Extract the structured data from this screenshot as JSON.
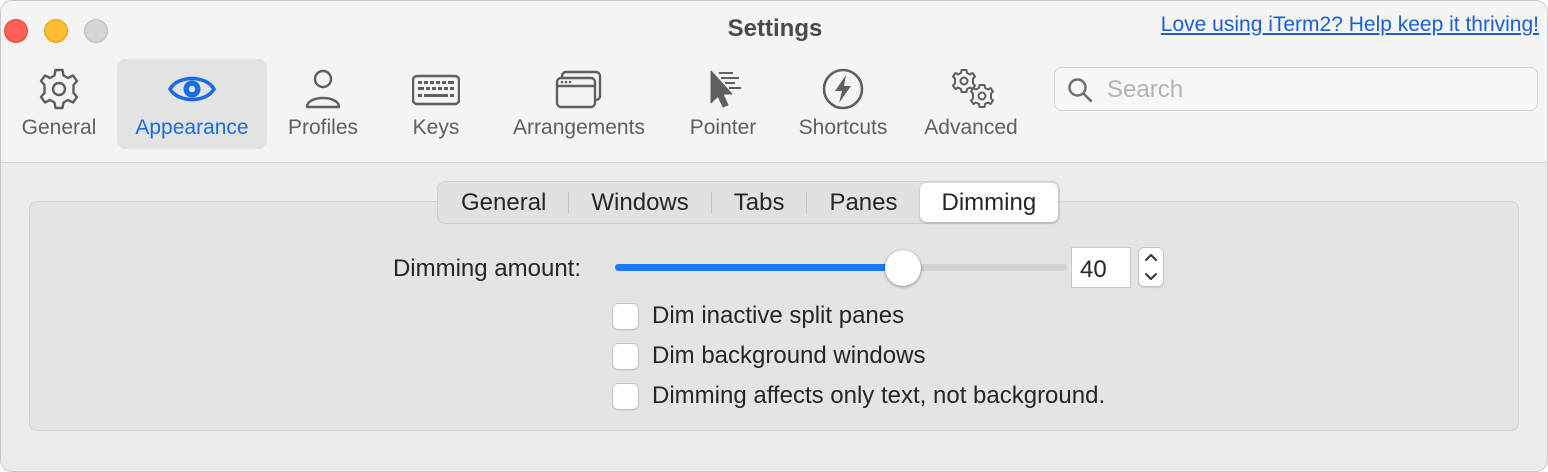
{
  "window": {
    "title": "Settings",
    "promo_link": "Love using iTerm2? Help keep it thriving!"
  },
  "toolbar": {
    "items": [
      {
        "label": "General",
        "icon": "gear-icon"
      },
      {
        "label": "Appearance",
        "icon": "eye-icon",
        "active": true
      },
      {
        "label": "Profiles",
        "icon": "person-icon"
      },
      {
        "label": "Keys",
        "icon": "keyboard-icon"
      },
      {
        "label": "Arrangements",
        "icon": "windows-icon"
      },
      {
        "label": "Pointer",
        "icon": "pointer-icon"
      },
      {
        "label": "Shortcuts",
        "icon": "bolt-icon"
      },
      {
        "label": "Advanced",
        "icon": "gears-icon"
      }
    ],
    "search_placeholder": "Search",
    "accent_color": "#1a6ce6"
  },
  "tabs": {
    "items": [
      "General",
      "Windows",
      "Tabs",
      "Panes",
      "Dimming"
    ],
    "selected": "Dimming"
  },
  "dimming": {
    "amount_label": "Dimming amount:",
    "amount_value": "40",
    "slider_fraction": 0.65,
    "checkboxes": [
      {
        "label": "Dim inactive split panes",
        "checked": false
      },
      {
        "label": "Dim background windows",
        "checked": false
      },
      {
        "label": "Dimming affects only text, not background.",
        "checked": false
      }
    ]
  }
}
